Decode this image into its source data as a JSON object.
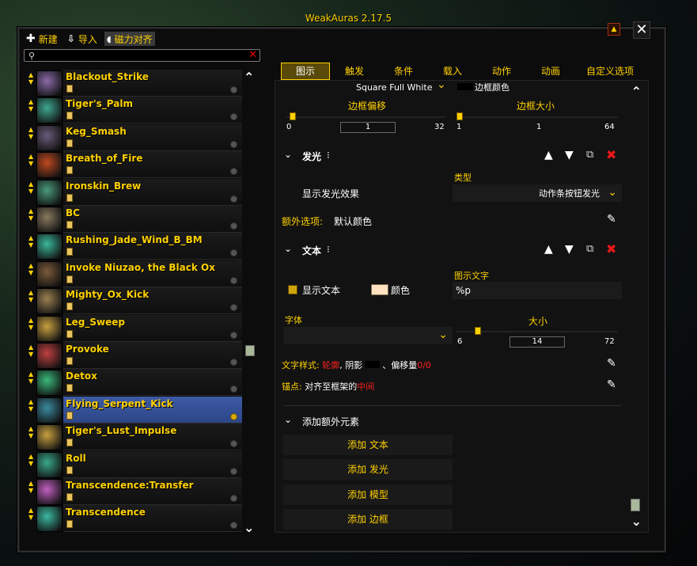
{
  "window": {
    "title": "WeakAuras 2.17.5",
    "close_glyph": "✕",
    "minimize_glyph": "▲"
  },
  "toolbar": {
    "new_label": "新建",
    "import_label": "导入",
    "snap_label": "磁力对齐"
  },
  "search": {
    "placeholder": "",
    "value": ""
  },
  "auras": [
    {
      "name": "Blackout_Strike",
      "color": "#8a6aa8"
    },
    {
      "name": "Tiger's_Palm",
      "color": "#3fa890"
    },
    {
      "name": "Keg_Smash",
      "color": "#6a5a7a"
    },
    {
      "name": "Breath_of_Fire",
      "color": "#c04a20"
    },
    {
      "name": "Ironskin_Brew",
      "color": "#4a9a7a"
    },
    {
      "name": "BC",
      "color": "#8a7a60"
    },
    {
      "name": "Rushing_Jade_Wind_B_BM",
      "color": "#3ab89a"
    },
    {
      "name": "Invoke Niuzao, the Black Ox",
      "color": "#7a5a3a"
    },
    {
      "name": "Mighty_Ox_Kick",
      "color": "#9a8050"
    },
    {
      "name": "Leg_Sweep",
      "color": "#c8a040"
    },
    {
      "name": "Provoke",
      "color": "#c04040"
    },
    {
      "name": "Detox",
      "color": "#3ab87a"
    },
    {
      "name": "Flying_Serpent_Kick",
      "color": "#3a8aa0",
      "selected": true
    },
    {
      "name": "Tiger's_Lust_Impulse",
      "color": "#c8a040"
    },
    {
      "name": "Roll",
      "color": "#3aa88a"
    },
    {
      "name": "Transcendence:Transfer",
      "color": "#c060c0"
    },
    {
      "name": "Transcendence",
      "color": "#3ab8a0"
    }
  ],
  "tabs": [
    {
      "label": "图示",
      "active": true
    },
    {
      "label": "触发"
    },
    {
      "label": "条件"
    },
    {
      "label": "载入"
    },
    {
      "label": "动作"
    },
    {
      "label": "动画"
    },
    {
      "label": "自定义选项"
    }
  ],
  "panel": {
    "border_texture_value": "Square Full White",
    "border_color_label": "边框颜色",
    "border_offset": {
      "label": "边框偏移",
      "min": "0",
      "value": "1",
      "max": "32"
    },
    "border_size": {
      "label": "边框大小",
      "min": "1",
      "value": "1",
      "max": "64"
    },
    "glow_section": {
      "title": "发光",
      "suffix": "⁝"
    },
    "show_glow_label": "显示发光效果",
    "glow_type_label": "类型",
    "glow_type_value": "动作条按钮发光",
    "extra_options_label": "额外选项:",
    "extra_options_value": "默认颜色",
    "text_section": {
      "title": "文本",
      "suffix": "⁝"
    },
    "show_text_label": "显示文本",
    "color_label": "颜色",
    "icon_text_label": "图示文字",
    "icon_text_value": "%p",
    "font_label": "字体",
    "size": {
      "label": "大小",
      "min": "6",
      "value": "14",
      "max": "72"
    },
    "text_style": {
      "prefix": "文字样式:",
      "outline": "轮廓",
      "comma": ",",
      "shadow": "阴影",
      "sep": "、",
      "offset_label": "偏移量",
      "offset_value": "0/0"
    },
    "anchor": {
      "prefix": "锚点:",
      "text": "对齐至框架的",
      "position": "中间"
    },
    "add_extra_section": "添加额外元素",
    "add_buttons": [
      "添加 文本",
      "添加 发光",
      "添加 模型",
      "添加 边框"
    ]
  },
  "colors": {
    "accent": "#ffd100",
    "selected_row": "#3d5aa5",
    "delete_red": "#e81818",
    "text_color_swatch": "#ffe2c0"
  },
  "icons": {
    "new": "plus-icon",
    "import": "import-icon",
    "snap": "magnet-icon",
    "search": "search-icon",
    "clear": "close-icon",
    "move_up": "arrow-up-icon",
    "move_down": "arrow-down-icon",
    "duplicate": "copy-icon",
    "delete": "delete-icon",
    "edit": "pencil-icon",
    "collapse": "chevron-down-icon"
  }
}
